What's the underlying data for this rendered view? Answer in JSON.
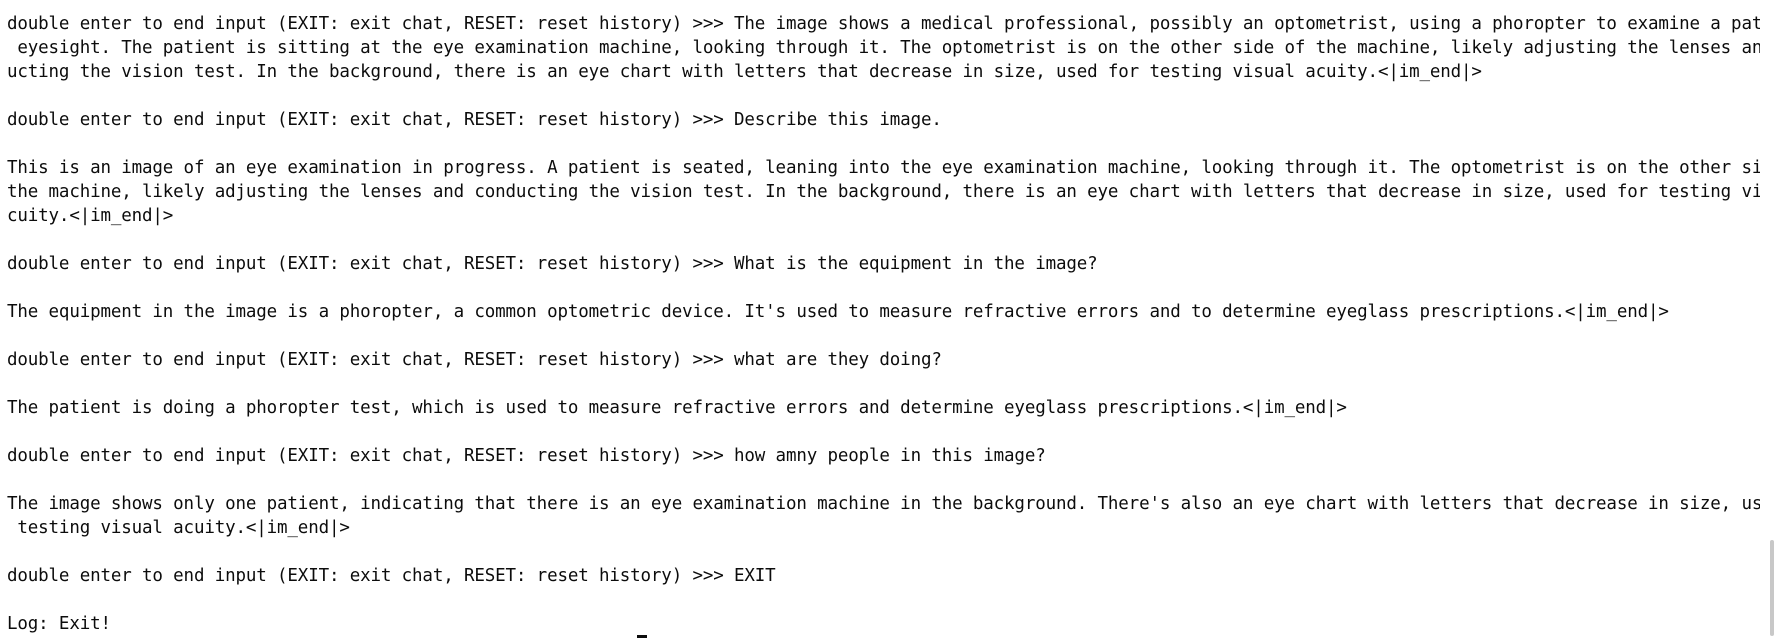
{
  "terminal": {
    "lines": [
      "double enter to end input (EXIT: exit chat, RESET: reset history) >>> The image shows a medical professional, possibly an optometrist, using a phoropter to examine a patient's",
      " eyesight. The patient is sitting at the eye examination machine, looking through it. The optometrist is on the other side of the machine, likely adjusting the lenses and cond",
      "ucting the vision test. In the background, there is an eye chart with letters that decrease in size, used for testing visual acuity.<|im_end|>",
      "",
      "double enter to end input (EXIT: exit chat, RESET: reset history) >>> Describe this image.",
      "",
      "This is an image of an eye examination in progress. A patient is seated, leaning into the eye examination machine, looking through it. The optometrist is on the other side of",
      "the machine, likely adjusting the lenses and conducting the vision test. In the background, there is an eye chart with letters that decrease in size, used for testing visual a",
      "cuity.<|im_end|>",
      "",
      "double enter to end input (EXIT: exit chat, RESET: reset history) >>> What is the equipment in the image?",
      "",
      "The equipment in the image is a phoropter, a common optometric device. It's used to measure refractive errors and to determine eyeglass prescriptions.<|im_end|>",
      "",
      "double enter to end input (EXIT: exit chat, RESET: reset history) >>> what are they doing?",
      "",
      "The patient is doing a phoropter test, which is used to measure refractive errors and determine eyeglass prescriptions.<|im_end|>",
      "",
      "double enter to end input (EXIT: exit chat, RESET: reset history) >>> how amny people in this image?",
      "",
      "The image shows only one patient, indicating that there is an eye examination machine in the background. There's also an eye chart with letters that decrease in size, used for",
      " testing visual acuity.<|im_end|>",
      "",
      "double enter to end input (EXIT: exit chat, RESET: reset history) >>> EXIT",
      "",
      "Log: Exit!"
    ]
  }
}
